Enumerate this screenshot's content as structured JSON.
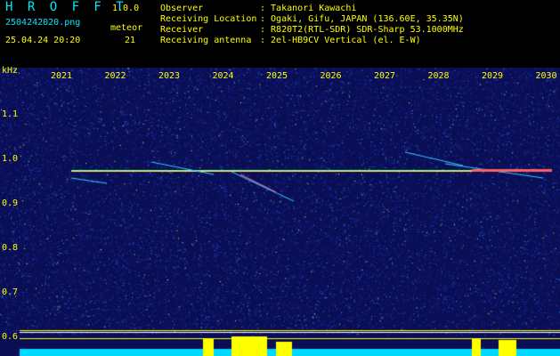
{
  "app": {
    "name": "H R O F F T",
    "version": "1.0.0"
  },
  "file": {
    "name": "2504242020.png",
    "datetime": "25.04.24 20:20"
  },
  "meteor": {
    "label": "meteor",
    "count": "21"
  },
  "info": {
    "observer_label": "Observer",
    "observer": ": Takanori Kawachi",
    "location_label": "Receiving Location",
    "location": ": Ogaki, Gifu, JAPAN (136.60E, 35.35N)",
    "receiver_label": "Receiver",
    "receiver": ": R820T2(RTL-SDR) SDR-Sharp 53.1000MHz",
    "antenna_label": "Receiving antenna",
    "antenna": ": 2el-HB9CV Vertical (el. E-W)"
  },
  "axis": {
    "unit": "kHz",
    "x_ticks": [
      "2021",
      "2022",
      "2023",
      "2024",
      "2025",
      "2026",
      "2027",
      "2028",
      "2029",
      "2030"
    ],
    "y_ticks": [
      "1.1",
      "1.0",
      "0.9",
      "0.8",
      "0.7",
      "0.6"
    ]
  },
  "colors": {
    "label": "#ffff00",
    "accent": "#00e8ff",
    "background": "#000000",
    "noise": "#1a2a9a"
  }
}
